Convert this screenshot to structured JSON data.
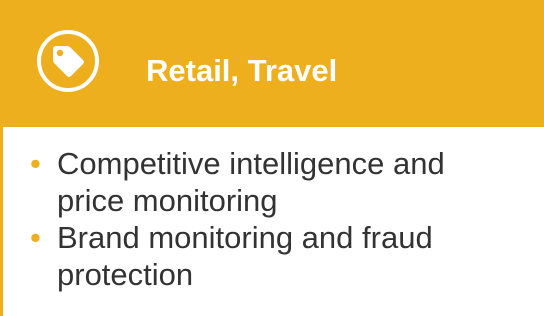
{
  "header": {
    "icon": "price-tag-icon",
    "title": "Retail, Travel"
  },
  "bullets": {
    "marker": "•",
    "items": [
      "Competitive intelligence and price monitoring",
      "Brand monitoring and fraud protection"
    ]
  },
  "colors": {
    "accent": "#EEAF1E",
    "text": "#333333",
    "header_text": "#FFFFFF"
  }
}
